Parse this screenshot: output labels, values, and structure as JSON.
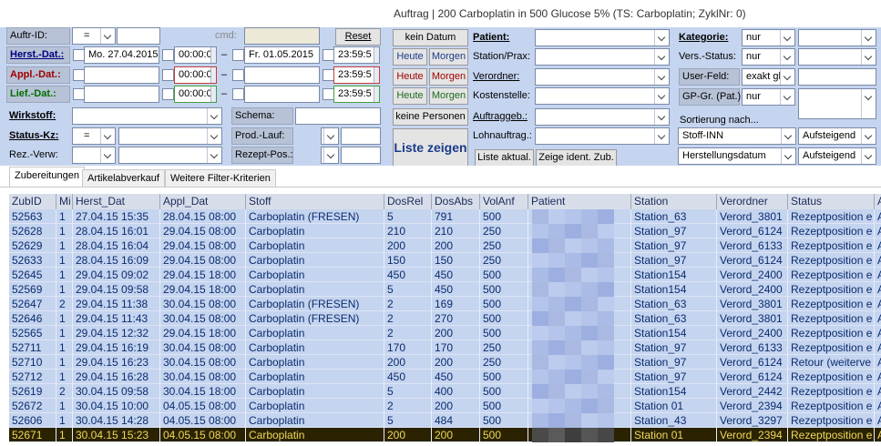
{
  "window": {
    "title": "Auftrag | 200 Carboplatin in 500 Glucose 5% (TS: Carboplatin; ZyklNr: 0)"
  },
  "filters": {
    "auftr_id": {
      "label": "Auftr-ID:",
      "op": "=",
      "value": ""
    },
    "cmd": {
      "label": "cmd:",
      "value": ""
    },
    "reset": "Reset",
    "herst_dat": {
      "label": "Herst.-Dat.:",
      "from": "Mo. 27.04.2015",
      "from_time": "00:00:0",
      "to": "Fr. 01.05.2015",
      "to_time": "23:59:5"
    },
    "appl_dat": {
      "label": "Appl.-Dat.:",
      "from": "",
      "from_time": "00:00:0",
      "to": "",
      "to_time": "23:59:5"
    },
    "lief_dat": {
      "label": "Lief.-Dat.:",
      "from": "",
      "from_time": "00:00:0",
      "to": "",
      "to_time": "23:59:5"
    },
    "dash": "–",
    "wirkstoff": {
      "label": "Wirkstoff:",
      "value": ""
    },
    "status_kz": {
      "label": "Status-Kz:",
      "op": "=",
      "value": ""
    },
    "rez_verw": {
      "label": "Rez.-Verw:",
      "value": ""
    },
    "schema": {
      "label": "Schema:",
      "value": ""
    },
    "prod_lauf": {
      "label": "Prod.-Lauf:",
      "value": ""
    },
    "rezept_pos": {
      "label": "Rezept-Pos.:",
      "value": ""
    },
    "buttons": {
      "kein_datum": "kein Datum",
      "heute": "Heute",
      "morgen": "Morgen",
      "keine_personen": "keine Personen",
      "liste_zeigen": "Liste zeigen",
      "liste_aktual": "Liste aktual.",
      "zeige_ident": "Zeige ident. Zub."
    },
    "patient": {
      "label": "Patient:",
      "value": ""
    },
    "station": {
      "label": "Station/Prax:",
      "value": ""
    },
    "verordner": {
      "label": "Verordner:",
      "value": ""
    },
    "kostenstelle": {
      "label": "Kostenstelle:",
      "value": ""
    },
    "auftraggeb": {
      "label": "Auftraggeb.:",
      "value": ""
    },
    "lohnauftrag": {
      "label": "Lohnauftrag.:",
      "value": ""
    },
    "kategorie": {
      "label": "Kategorie:",
      "mode": "nur",
      "value": ""
    },
    "vers_status": {
      "label": "Vers.-Status:",
      "mode": "nur",
      "value": ""
    },
    "user_feld": {
      "label": "User-Feld:",
      "mode": "exakt gl",
      "value": ""
    },
    "gp_gr": {
      "label": "GP-Gr. (Pat.):",
      "mode": "nur",
      "value": ""
    },
    "sortierung": {
      "label": "Sortierung nach...",
      "sort1": "Stoff-INN",
      "dir1": "Aufsteigend",
      "sort2": "Herstellungsdatum",
      "dir2": "Aufsteigend"
    }
  },
  "tabs": [
    "Zubereitungen",
    "Artikelabverkauf",
    "Weitere Filter-Kriterien"
  ],
  "grid": {
    "columns": [
      "ZubID",
      "Mi",
      "Herst_Dat",
      "Appl_Dat",
      "Stoff",
      "DosRel",
      "DosAbs",
      "VolAnf",
      "Patient",
      "Station",
      "Verordner",
      "Status",
      "A"
    ],
    "rows": [
      [
        "52563",
        "1",
        "27.04.15 15:35",
        "28.04.15 08:00",
        "Carboplatin (FRESEN)",
        "5",
        "791",
        "500",
        "",
        "Station_63",
        "Verord_3801",
        "Rezeptposition e",
        "A"
      ],
      [
        "52628",
        "1",
        "28.04.15 16:01",
        "29.04.15 08:00",
        "Carboplatin",
        "210",
        "210",
        "250",
        "",
        "Station_97",
        "Verord_6124",
        "Rezeptposition e",
        "A"
      ],
      [
        "52629",
        "1",
        "28.04.15 16:04",
        "29.04.15 08:00",
        "Carboplatin",
        "200",
        "200",
        "250",
        "",
        "Station_97",
        "Verord_6133",
        "Rezeptposition e",
        "A"
      ],
      [
        "52633",
        "1",
        "28.04.15 16:09",
        "29.04.15 08:00",
        "Carboplatin",
        "150",
        "150",
        "250",
        "",
        "Station_97",
        "Verord_6124",
        "Rezeptposition e",
        "A"
      ],
      [
        "52645",
        "1",
        "29.04.15 09:02",
        "29.04.15 18:00",
        "Carboplatin",
        "450",
        "450",
        "500",
        "",
        "Station154",
        "Verord_2400",
        "Rezeptposition e",
        "A"
      ],
      [
        "52569",
        "1",
        "29.04.15 09:58",
        "29.04.15 18:00",
        "Carboplatin",
        "5",
        "450",
        "500",
        "",
        "Station154",
        "Verord_2400",
        "Rezeptposition e",
        "A"
      ],
      [
        "52647",
        "2",
        "29.04.15 11:38",
        "30.04.15 08:00",
        "Carboplatin (FRESEN)",
        "2",
        "169",
        "500",
        "",
        "Station_63",
        "Verord_3801",
        "Rezeptposition e",
        "A"
      ],
      [
        "52646",
        "1",
        "29.04.15 11:43",
        "30.04.15 08:00",
        "Carboplatin (FRESEN)",
        "2",
        "270",
        "500",
        "",
        "Station_63",
        "Verord_3801",
        "Rezeptposition e",
        "A"
      ],
      [
        "52565",
        "1",
        "29.04.15 12:32",
        "29.04.15 18:00",
        "Carboplatin",
        "2",
        "200",
        "500",
        "",
        "Station154",
        "Verord_2400",
        "Rezeptposition e",
        "A"
      ],
      [
        "52711",
        "1",
        "29.04.15 16:19",
        "30.04.15 08:00",
        "Carboplatin",
        "170",
        "170",
        "250",
        "",
        "Station_97",
        "Verord_6133",
        "Rezeptposition e",
        "A"
      ],
      [
        "52710",
        "1",
        "29.04.15 16:23",
        "30.04.15 08:00",
        "Carboplatin",
        "200",
        "200",
        "250",
        "",
        "Station_97",
        "Verord_6124",
        "Retour (weiterve",
        "A"
      ],
      [
        "52712",
        "1",
        "29.04.15 16:28",
        "30.04.15 08:00",
        "Carboplatin",
        "450",
        "450",
        "500",
        "",
        "Station_97",
        "Verord_6124",
        "Rezeptposition e",
        "A"
      ],
      [
        "52619",
        "2",
        "30.04.15 09:58",
        "30.04.15 18:00",
        "Carboplatin",
        "5",
        "400",
        "500",
        "",
        "Station154",
        "Verord_2442",
        "Rezeptposition e",
        "A"
      ],
      [
        "52672",
        "1",
        "30.04.15 10:00",
        "04.05.15 08:00",
        "Carboplatin",
        "2",
        "200",
        "500",
        "",
        "Station 01",
        "Verord_2394",
        "Rezeptposition e",
        "A"
      ],
      [
        "52606",
        "1",
        "30.04.15 14:28",
        "04.05.15 08:00",
        "Carboplatin",
        "5",
        "484",
        "500",
        "",
        "Station_43",
        "Verord_3297",
        "Rezeptposition e",
        "A"
      ],
      [
        "52671",
        "1",
        "30.04.15 15:23",
        "04.05.15 08:00",
        "Carboplatin",
        "200",
        "200",
        "500",
        "",
        "Station 01",
        "Verord_2394",
        "Rezeptposition e",
        "A"
      ]
    ],
    "selected_row": 15
  },
  "colors": {
    "panel_bg": "#c5d4ef",
    "grid_row_bg": "#c5d4ef",
    "selected_row_bg": "#2a2200",
    "selected_text": "#f0d860",
    "cell_text": "#0a2c6e"
  }
}
